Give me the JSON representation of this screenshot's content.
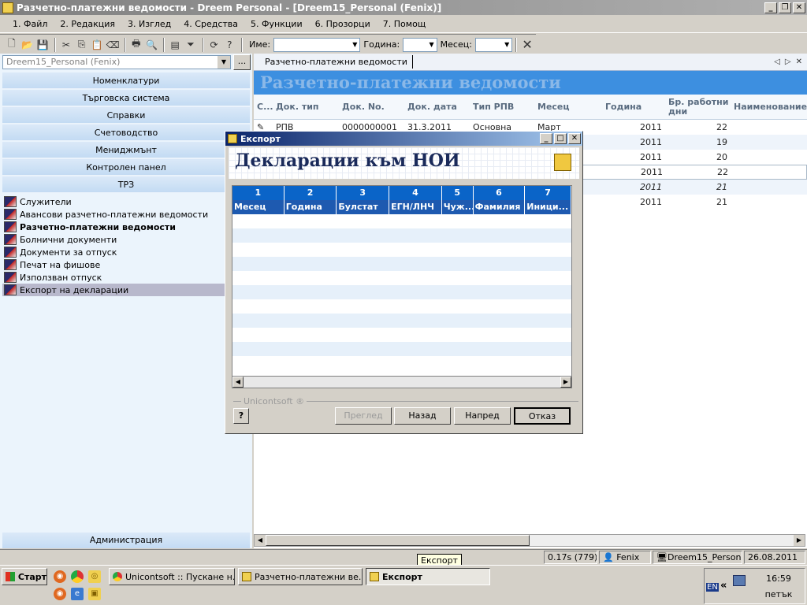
{
  "window": {
    "title": "Разчетно-платежни ведомости - Dreem Personal - [Dreem15_Personal (Fenix)]",
    "controls": [
      "_",
      "❐",
      "✕"
    ]
  },
  "menu": [
    "1. Файл",
    "2. Редакция",
    "3. Изглед",
    "4. Средства",
    "5. Функции",
    "6. Прозорци",
    "7. Помощ"
  ],
  "toolbar": {
    "name_label": "Име:",
    "year_label": "Година:",
    "month_label": "Месец:",
    "name_value": "",
    "year_value": "",
    "month_value": ""
  },
  "left": {
    "db_combo": "Dreem15_Personal (Fenix)",
    "dots": "...",
    "sections": [
      "Номенклатури",
      "Търговска система",
      "Справки",
      "Счетоводство",
      "Мениджмънт",
      "Контролен панел",
      "ТРЗ"
    ],
    "items": [
      {
        "label": "Служители"
      },
      {
        "label": "Авансови разчетно-платежни ведомости"
      },
      {
        "label": "Разчетно-платежни ведомости"
      },
      {
        "label": "Болнични документи"
      },
      {
        "label": "Документи за отпуск"
      },
      {
        "label": "Печат на фишове"
      },
      {
        "label": "Използван отпуск"
      },
      {
        "label": "Експорт на декларации"
      }
    ],
    "admin": "Администрация"
  },
  "doc": {
    "tab": "Разчетно-платежни ведомости",
    "title": "Разчетно-платежни ведомости",
    "columns": [
      "С...",
      "Док. тип",
      "Док. No.",
      "Док. дата",
      "Тип РПВ",
      "Месец",
      "Година",
      "Бр. работни дни",
      "Наименование"
    ],
    "rows": [
      {
        "type": "РПВ",
        "no": "0000000001",
        "date": "31.3.2011",
        "rpv": "Основна",
        "month": "Март",
        "year": "2011",
        "days": "22"
      },
      {
        "type": "",
        "no": "",
        "date": "",
        "rpv": "",
        "month": "",
        "year": "2011",
        "days": "19"
      },
      {
        "type": "",
        "no": "",
        "date": "",
        "rpv": "",
        "month": "",
        "year": "2011",
        "days": "20"
      },
      {
        "type": "",
        "no": "",
        "date": "",
        "rpv": "",
        "month": "",
        "year": "2011",
        "days": "22"
      },
      {
        "type": "",
        "no": "",
        "date": "",
        "rpv": "",
        "month": "",
        "year": "2011",
        "days": "21"
      },
      {
        "type": "",
        "no": "",
        "date": "",
        "rpv": "",
        "month": "",
        "year": "2011",
        "days": "21"
      }
    ]
  },
  "dialog": {
    "title": "Експорт",
    "heading": "Декларации към НОИ",
    "col_numbers": [
      "1",
      "2",
      "3",
      "4",
      "5",
      "6",
      "7"
    ],
    "col_names": [
      "Месец",
      "Година",
      "Булстат",
      "ЕГН/ЛНЧ",
      "Чуж...",
      "Фамилия",
      "Иници..."
    ],
    "brand": "Unicontsoft ®",
    "help": "?",
    "buttons": {
      "preview": "Преглед",
      "back": "Назад",
      "next": "Напред",
      "cancel": "Отказ"
    }
  },
  "status": {
    "timing": "0.17s (779)",
    "user": "Fenix",
    "db": "Dreem15_Personal",
    "date": "26.08.2011",
    "tooltip": "Експорт"
  },
  "taskbar": {
    "start": "Старт",
    "tasks": [
      "Unicontsoft :: Пускане н...",
      "Разчетно-платежни ве...",
      "Експорт"
    ],
    "lang": "EN",
    "time": "16:59",
    "day": "петък"
  }
}
